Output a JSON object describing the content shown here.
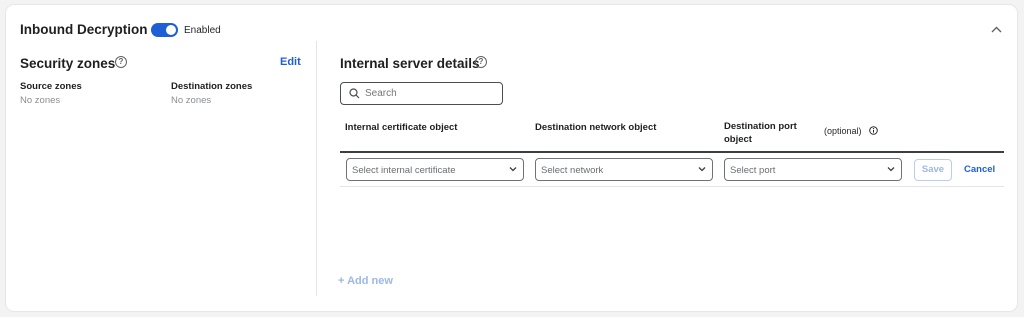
{
  "header": {
    "title": "Inbound Decryption",
    "toggle_label": "Enabled"
  },
  "security_zones": {
    "title": "Security zones",
    "edit_label": "Edit",
    "source_label": "Source zones",
    "source_value": "No zones",
    "destination_label": "Destination zones",
    "destination_value": "No zones"
  },
  "internal_server": {
    "title": "Internal server details",
    "search_placeholder": "Search",
    "columns": {
      "certificate": "Internal certificate object",
      "network": "Destination network object",
      "port": "Destination port object",
      "optional": "(optional)"
    },
    "row": {
      "certificate_placeholder": "Select internal certificate",
      "network_placeholder": "Select network",
      "port_placeholder": "Select port",
      "save_label": "Save",
      "cancel_label": "Cancel"
    },
    "add_new_label": "+ Add new"
  },
  "colors": {
    "accent": "#1f5fd6",
    "disabled_accent": "#9db7e6"
  },
  "icons": {
    "collapse": "chevron-up-icon",
    "help": "help-circle-icon",
    "search": "search-icon",
    "dropdown": "chevron-down-icon",
    "info": "info-icon"
  }
}
